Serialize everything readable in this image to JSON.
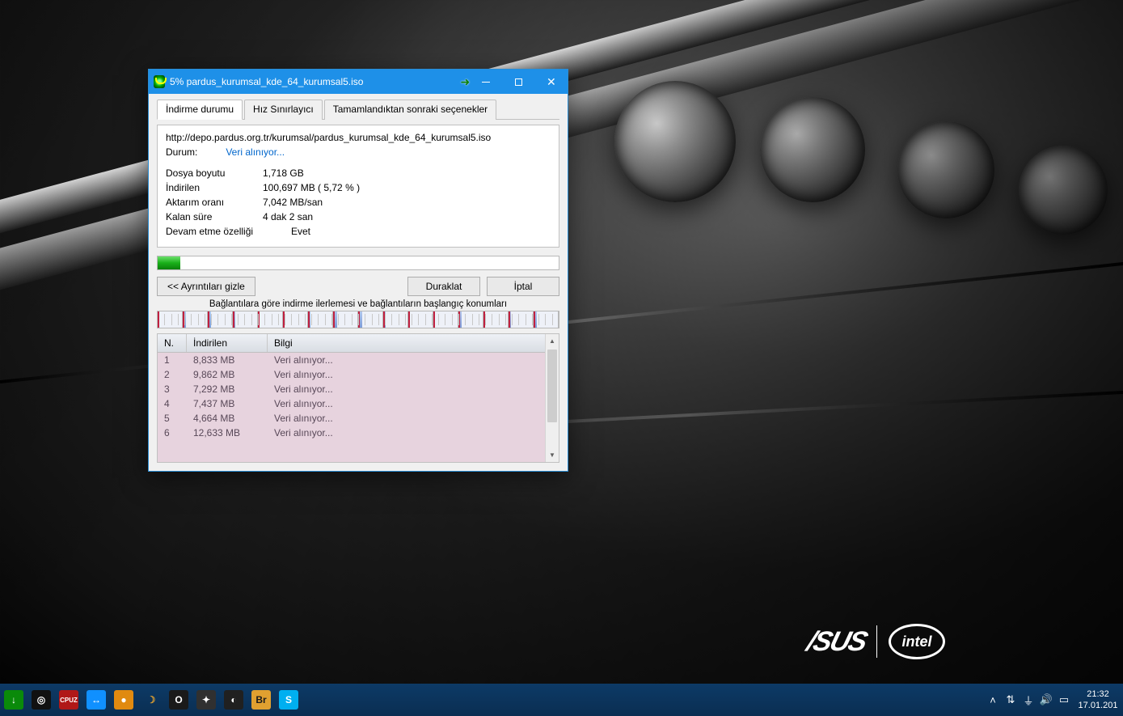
{
  "window": {
    "title": "5% pardus_kurumsal_kde_64_kurumsal5.iso",
    "tabs": {
      "status": "İndirme durumu",
      "speed_limit": "Hız Sınırlayıcı",
      "on_complete": "Tamamlandıktan sonraki seçenekler"
    },
    "url": "http://depo.pardus.org.tr/kurumsal/pardus_kurumsal_kde_64_kurumsal5.iso",
    "status_label": "Durum:",
    "status_value": "Veri alınıyor...",
    "rows": {
      "file_size_k": "Dosya boyutu",
      "file_size_v": "1,718  GB",
      "downloaded_k": "İndirilen",
      "downloaded_v": "100,697  MB  ( 5,72 % )",
      "rate_k": "Aktarım oranı",
      "rate_v": "7,042  MB/san",
      "time_left_k": "Kalan süre",
      "time_left_v": "4 dak 2 san",
      "resume_k": "Devam etme özelliği",
      "resume_v": "Evet"
    },
    "progress_percent": 5.72,
    "buttons": {
      "hide_details": "<< Ayrıntıları gizle",
      "pause": "Duraklat",
      "cancel": "İptal"
    },
    "connections_label": "Bağlantılara göre indirme ilerlemesi ve bağlantıların başlangıç konumları",
    "table": {
      "hn": "N.",
      "hdl": "İndirilen",
      "hinfo": "Bilgi",
      "rows": [
        {
          "n": "1",
          "dl": "8,833  MB",
          "info": "Veri alınıyor..."
        },
        {
          "n": "2",
          "dl": "9,862  MB",
          "info": "Veri alınıyor..."
        },
        {
          "n": "3",
          "dl": "7,292  MB",
          "info": "Veri alınıyor..."
        },
        {
          "n": "4",
          "dl": "7,437  MB",
          "info": "Veri alınıyor..."
        },
        {
          "n": "5",
          "dl": "4,664  MB",
          "info": "Veri alınıyor..."
        },
        {
          "n": "6",
          "dl": "12,633  MB",
          "info": "Veri alınıyor..."
        }
      ]
    }
  },
  "brand": {
    "asus": "/SUS",
    "intel": "intel"
  },
  "taskbar": {
    "apps": [
      {
        "name": "idm-tray-icon",
        "bg": "#0a8a0a",
        "label": "↓"
      },
      {
        "name": "firefox-icon",
        "bg": "#111",
        "label": "◎"
      },
      {
        "name": "cpuz-icon",
        "bg": "#b01818",
        "label": "CPUZ"
      },
      {
        "name": "teamviewer-icon",
        "bg": "#1090ff",
        "label": "↔"
      },
      {
        "name": "daemon-icon",
        "bg": "#e08a10",
        "label": "●"
      },
      {
        "name": "moon-icon",
        "bg": "transparent",
        "label": "☽"
      },
      {
        "name": "origin-icon",
        "bg": "#1a1a1a",
        "label": "O"
      },
      {
        "name": "game1-icon",
        "bg": "#303030",
        "label": "✦"
      },
      {
        "name": "game2-icon",
        "bg": "#202020",
        "label": "◐"
      },
      {
        "name": "bridge-icon",
        "bg": "#e0a030",
        "label": "Br"
      },
      {
        "name": "skype-icon",
        "bg": "#00aff0",
        "label": "S"
      }
    ],
    "tray": [
      {
        "name": "tray-up-icon",
        "glyph": "˄"
      },
      {
        "name": "tray-network-icon",
        "glyph": "⇅"
      },
      {
        "name": "tray-wifi-icon",
        "glyph": "⏚"
      },
      {
        "name": "tray-volume-icon",
        "glyph": "🔊"
      },
      {
        "name": "tray-actioncenter-icon",
        "glyph": "▭"
      }
    ],
    "clock": {
      "time": "21:32",
      "date": "17.01.201"
    }
  }
}
